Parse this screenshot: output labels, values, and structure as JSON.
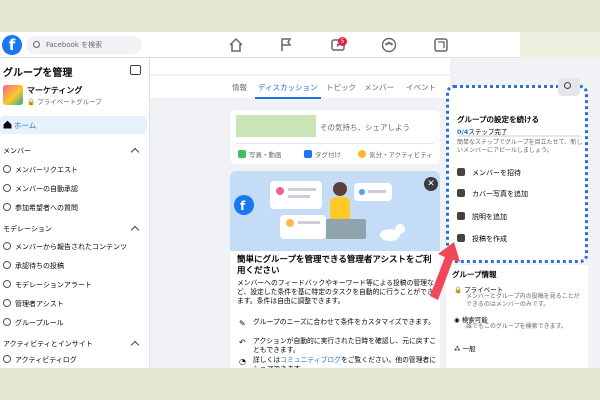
{
  "topbar": {
    "logo": "f",
    "search_placeholder": "Facebook を検索",
    "notification_count": "5"
  },
  "sidebar": {
    "title": "グループを管理",
    "group_name": "マーケティング",
    "group_privacy": "🔒 プライベートグループ",
    "home": "ホーム",
    "section_members": "メンバー",
    "member_items": [
      "メンバーリクエスト",
      "メンバーの自動承認",
      "参加希望者への質問"
    ],
    "section_moderation": "モデレーション",
    "moderation_items": [
      "メンバーから報告されたコンテンツ",
      "承認待ちの投稿",
      "モデレーションアラート",
      "管理者アシスト",
      "グループルール"
    ],
    "section_activity": "アクティビティとインサイト",
    "activity_items": [
      "アクティビティログ"
    ]
  },
  "tabs": [
    "情報",
    "ディスカッション",
    "トピック",
    "メンバー",
    "イベント"
  ],
  "composer": {
    "placeholder": "その気持ち、シェアしよう",
    "actions": [
      "写真・動画",
      "タグ付け",
      "気分・アクティビティ"
    ]
  },
  "assistant_card": {
    "title": "簡単にグループを管理できる管理者アシストをご利用ください",
    "description": "メンバーへのフィードバックやキーワード等による投稿の管理など、設定した条件を基に特定のタスクを自動的に行うことができます。条件は自由に調整できます。",
    "row1": "グループのニーズに合わせて条件をカスタマイズできます。",
    "row2": "アクションが自動的に実行された日時を確認し、元に戻すこともできます。",
    "row3_pre": "詳しくは",
    "row3_link": "コミュニティブログ",
    "row3_post": "をご覧ください。他の管理者にシェアできます。"
  },
  "setup_panel": {
    "title": "グループの設定を続ける",
    "steps_done": "0/4",
    "steps_label": "ステップ完了",
    "description": "簡単なステップでグループを目立たせて、新しいメンバーにアピールしましょう。",
    "items": [
      "メンバーを招待",
      "カバー写真を追加",
      "説明を追加",
      "投稿を作成"
    ]
  },
  "group_info": {
    "title": "グループ情報",
    "privacy": "プライベート",
    "privacy_desc": "メンバーとグループ内の投稿を見ることができるのはメンバーのみです。",
    "visibility": "検索可能",
    "visibility_desc": "誰でもこのグループを検索できます。",
    "general": "一般"
  },
  "colors": {
    "accent": "#1b74e4",
    "highlight_border": "#2d6fd6",
    "arrow": "#f0485a"
  }
}
